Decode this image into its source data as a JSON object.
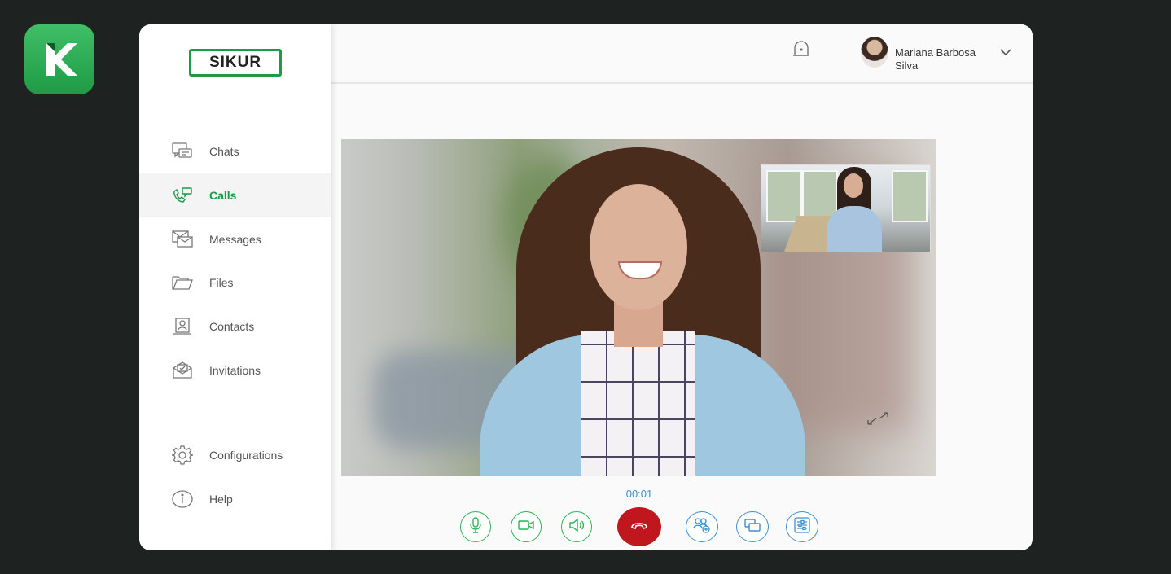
{
  "brand": {
    "logo_text": "SIKUR",
    "accent": "#1d9a44"
  },
  "sidebar": {
    "items": [
      {
        "label": "Chats",
        "icon": "chats-icon"
      },
      {
        "label": "Calls",
        "icon": "calls-icon",
        "active": true
      },
      {
        "label": "Messages",
        "icon": "messages-icon"
      },
      {
        "label": "Files",
        "icon": "folder-icon"
      },
      {
        "label": "Contacts",
        "icon": "contacts-icon"
      },
      {
        "label": "Invitations",
        "icon": "invitations-icon"
      },
      {
        "label": "Configurations",
        "icon": "gear-icon"
      },
      {
        "label": "Help",
        "icon": "info-icon"
      }
    ]
  },
  "header": {
    "user_name_line1": "Mariana Barbosa",
    "user_name_line2": "Silva"
  },
  "call": {
    "timer": "00:01",
    "controls": [
      "microphone-icon",
      "video-camera-icon",
      "speaker-icon",
      "hang-up-icon",
      "add-participant-icon",
      "share-screen-icon",
      "call-settings-icon"
    ],
    "colors": {
      "audio_controls": "#2fb452",
      "extra_controls": "#3d8fd1",
      "hang_up": "#c0161d",
      "timer": "#3d8fd1"
    }
  }
}
